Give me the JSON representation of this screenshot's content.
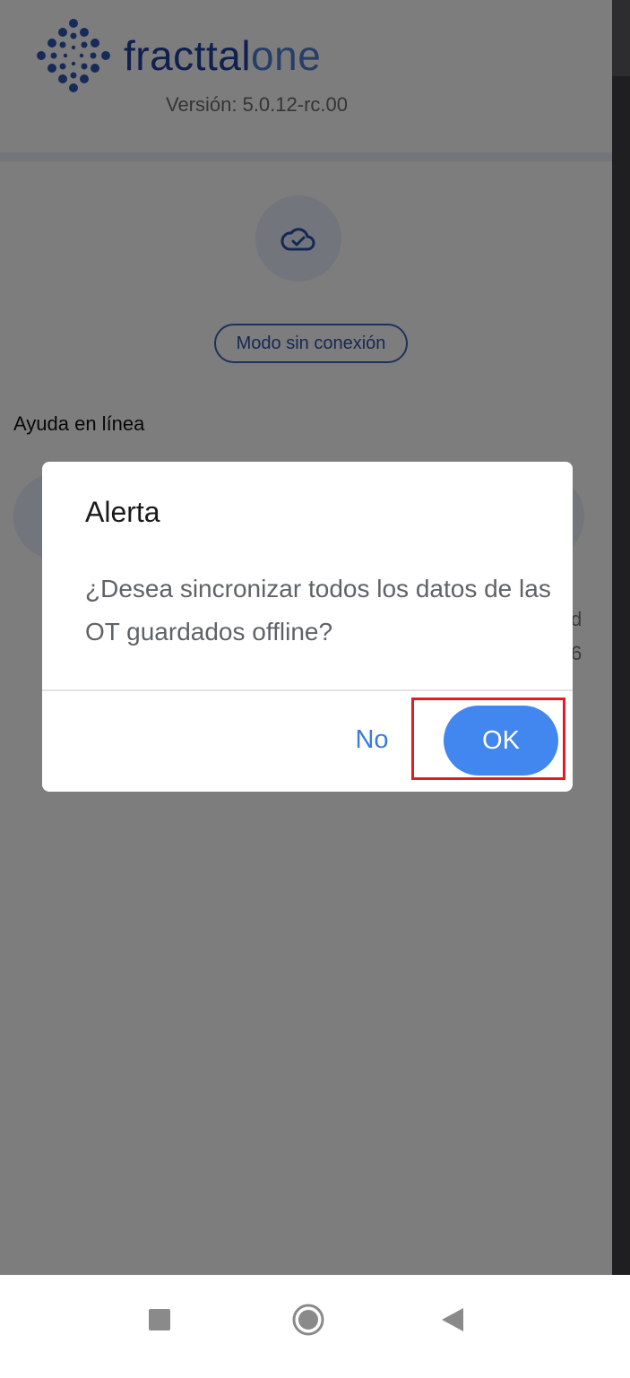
{
  "app": {
    "logo_text_primary": "fracttal",
    "logo_text_secondary": "one",
    "version": "Versión: 5.0.12-rc.00",
    "offline_mode_label": "Modo sin conexión",
    "help_label": "Ayuda en línea",
    "background_fragments": [
      "d",
      "6"
    ]
  },
  "dialog": {
    "title": "Alerta",
    "message": "¿Desea sincronizar todos los datos de las OT guardados offline?",
    "cancel_label": "No",
    "ok_label": "OK"
  },
  "colors": {
    "brand_dark": "#1e3f9c",
    "brand_light": "#4f7dd0",
    "ok_button": "#4286ef",
    "highlight": "#e31b23"
  },
  "icons": {
    "cloud": "cloud-check-icon",
    "nav_recents": "square-icon",
    "nav_home": "circle-icon",
    "nav_back": "triangle-back-icon"
  }
}
